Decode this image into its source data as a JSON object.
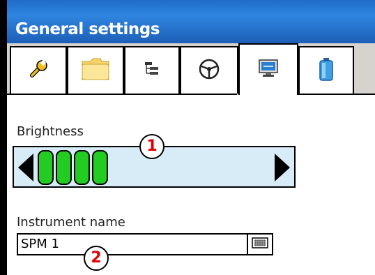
{
  "window": {
    "title": "General settings"
  },
  "tabs": [
    {
      "name": "tools-tab",
      "icon": "wrench-icon",
      "active": false
    },
    {
      "name": "folder-tab",
      "icon": "folder-icon",
      "active": false
    },
    {
      "name": "tree-tab",
      "icon": "tree-list-icon",
      "active": false
    },
    {
      "name": "steering-tab",
      "icon": "steering-wheel-icon",
      "active": false
    },
    {
      "name": "display-tab",
      "icon": "monitor-icon",
      "active": true
    },
    {
      "name": "battery-tab",
      "icon": "battery-icon",
      "active": false
    }
  ],
  "brightness": {
    "label": "Brightness",
    "level_segments": 4,
    "max_segments": 13
  },
  "instrument": {
    "label": "Instrument name",
    "value": "SPM 1",
    "keyboard_icon": "keyboard-icon"
  },
  "callouts": {
    "one": "1",
    "two": "2"
  },
  "colors": {
    "titlebar": "#2f86e0",
    "slider_bg": "#d8ecf8",
    "segment": "#22cc22",
    "callout": "#e00000"
  }
}
